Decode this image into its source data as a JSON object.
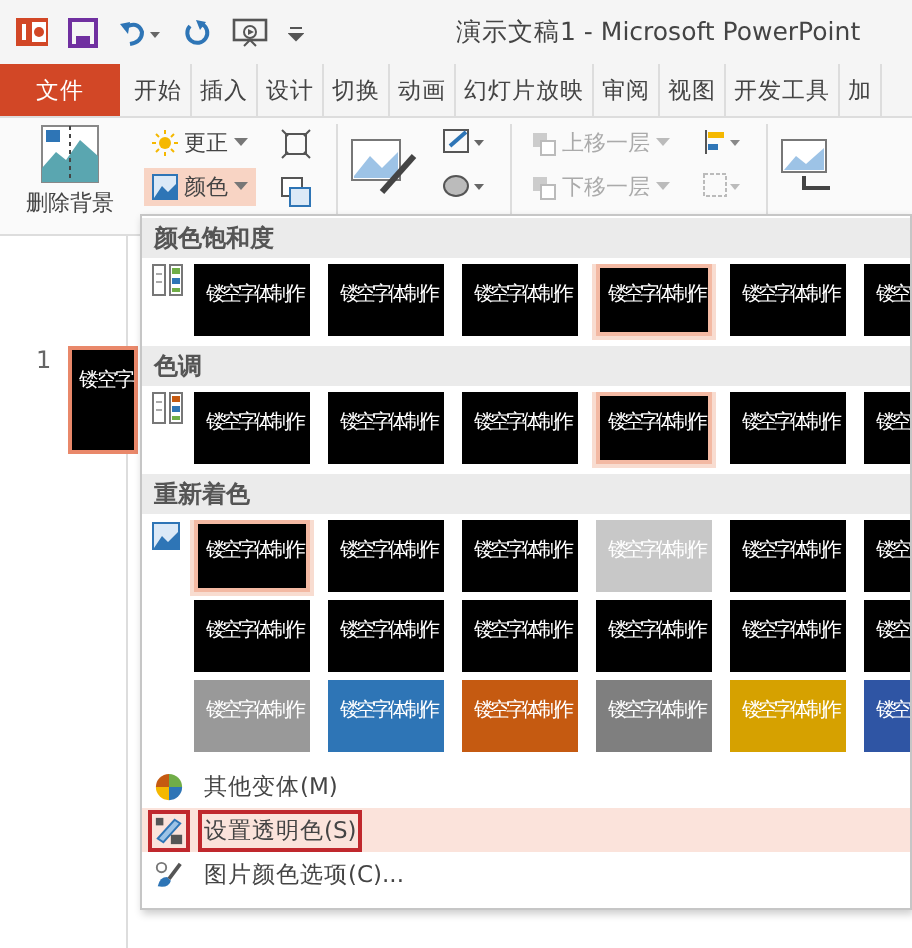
{
  "title_bar": {
    "title": "演示文稿1 - Microsoft PowerPoint"
  },
  "tabs": [
    {
      "label": "文件",
      "kind": "file"
    },
    {
      "label": "开始",
      "kind": "tab"
    },
    {
      "label": "插入",
      "kind": "tab"
    },
    {
      "label": "设计",
      "kind": "tab"
    },
    {
      "label": "切换",
      "kind": "tab"
    },
    {
      "label": "动画",
      "kind": "tab"
    },
    {
      "label": "幻灯片放映",
      "kind": "tab"
    },
    {
      "label": "审阅",
      "kind": "tab"
    },
    {
      "label": "视图",
      "kind": "tab"
    },
    {
      "label": "开发工具",
      "kind": "tab"
    },
    {
      "label": "加",
      "kind": "tab"
    }
  ],
  "ribbon": {
    "remove_background": "删除背景",
    "adjust": [
      {
        "label": "更正",
        "selected": false
      },
      {
        "label": "颜色",
        "selected": true
      }
    ],
    "arrange": [
      {
        "label": "上移一层",
        "disabled": true
      },
      {
        "label": "下移一层",
        "disabled": true
      }
    ]
  },
  "slides_pane": {
    "slides": [
      {
        "number": "1",
        "text": "镂空字",
        "selected": true
      }
    ]
  },
  "color_menu": {
    "sections": [
      {
        "title": "颜色饱和度",
        "rows": [
          [
            {
              "text": "镂空字体制作",
              "color": "#000000",
              "selected": false
            },
            {
              "text": "镂空字体制作",
              "color": "#000000",
              "selected": false
            },
            {
              "text": "镂空字体制作",
              "color": "#000000",
              "selected": false
            },
            {
              "text": "镂空字体制作",
              "color": "#000000",
              "selected": true
            },
            {
              "text": "镂空字体制作",
              "color": "#000000",
              "selected": false
            },
            {
              "text": "镂空",
              "color": "#000000",
              "selected": false
            }
          ]
        ]
      },
      {
        "title": "色调",
        "rows": [
          [
            {
              "text": "镂空字体制作",
              "color": "#000000",
              "selected": false
            },
            {
              "text": "镂空字体制作",
              "color": "#000000",
              "selected": false
            },
            {
              "text": "镂空字体制作",
              "color": "#000000",
              "selected": false
            },
            {
              "text": "镂空字体制作",
              "color": "#000000",
              "selected": true
            },
            {
              "text": "镂空字体制作",
              "color": "#000000",
              "selected": false
            },
            {
              "text": "镂空",
              "color": "#000000",
              "selected": false
            }
          ]
        ]
      },
      {
        "title": "重新着色",
        "rows": [
          [
            {
              "text": "镂空字体制作",
              "color": "#000000",
              "selected": true
            },
            {
              "text": "镂空字体制作",
              "color": "#000000",
              "selected": false
            },
            {
              "text": "镂空字体制作",
              "color": "#000000",
              "selected": false
            },
            {
              "text": "镂空字体制作",
              "color": "#c8c8c8",
              "selected": false
            },
            {
              "text": "镂空字体制作",
              "color": "#000000",
              "selected": false
            },
            {
              "text": "镂空",
              "color": "#000000",
              "selected": false
            }
          ],
          [
            {
              "text": "镂空字体制作",
              "color": "#000000",
              "selected": false
            },
            {
              "text": "镂空字体制作",
              "color": "#000000",
              "selected": false
            },
            {
              "text": "镂空字体制作",
              "color": "#000000",
              "selected": false
            },
            {
              "text": "镂空字体制作",
              "color": "#000000",
              "selected": false
            },
            {
              "text": "镂空字体制作",
              "color": "#000000",
              "selected": false
            },
            {
              "text": "镂空",
              "color": "#000000",
              "selected": false
            }
          ],
          [
            {
              "text": "镂空字体制作",
              "color": "#999999",
              "selected": false
            },
            {
              "text": "镂空字体制作",
              "color": "#2e75b6",
              "selected": false
            },
            {
              "text": "镂空字体制作",
              "color": "#c55a11",
              "selected": false
            },
            {
              "text": "镂空字体制作",
              "color": "#7f7f7f",
              "selected": false
            },
            {
              "text": "镂空字体制作",
              "color": "#d6a100",
              "selected": false
            },
            {
              "text": "镂空",
              "color": "#2f55a4",
              "selected": false
            }
          ]
        ]
      }
    ],
    "commands": [
      {
        "label": "其他变体(M)",
        "selected": false
      },
      {
        "label": "设置透明色(S)",
        "selected": true
      },
      {
        "label": "图片颜色选项(C)...",
        "selected": false
      }
    ]
  }
}
